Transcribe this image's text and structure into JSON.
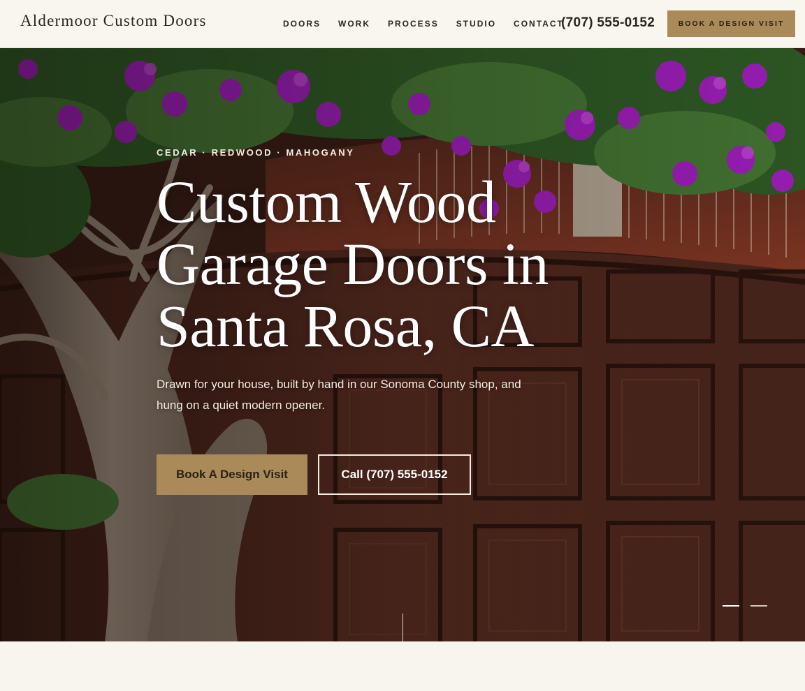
{
  "header": {
    "brand": "Aldermoor Custom Doors",
    "nav": [
      "DOORS",
      "WORK",
      "PROCESS",
      "STUDIO",
      "CONTACT"
    ],
    "phone": "(707) 555-0152",
    "cta": "BOOK A DESIGN VISIT"
  },
  "hero": {
    "eyebrow": "CEDAR · REDWOOD · MAHOGANY",
    "headline": [
      "Custom Wood",
      "Garage Doors in",
      "Santa Rosa, CA"
    ],
    "subhead": "Drawn for your house, built by hand in our Sonoma County shop, and hung on a quiet modern opener.",
    "primary_button": "Book A Design Visit",
    "secondary_button": "Call (707) 555-0152",
    "slides": {
      "count": 2,
      "active": 1
    }
  },
  "colors": {
    "accent": "#a98a58",
    "page_bg": "#f8f4ee",
    "text_dark": "#2a2523",
    "bougainvillea": "#a51fc4",
    "wood": "#5a2c20",
    "brick": "#7a3524"
  }
}
